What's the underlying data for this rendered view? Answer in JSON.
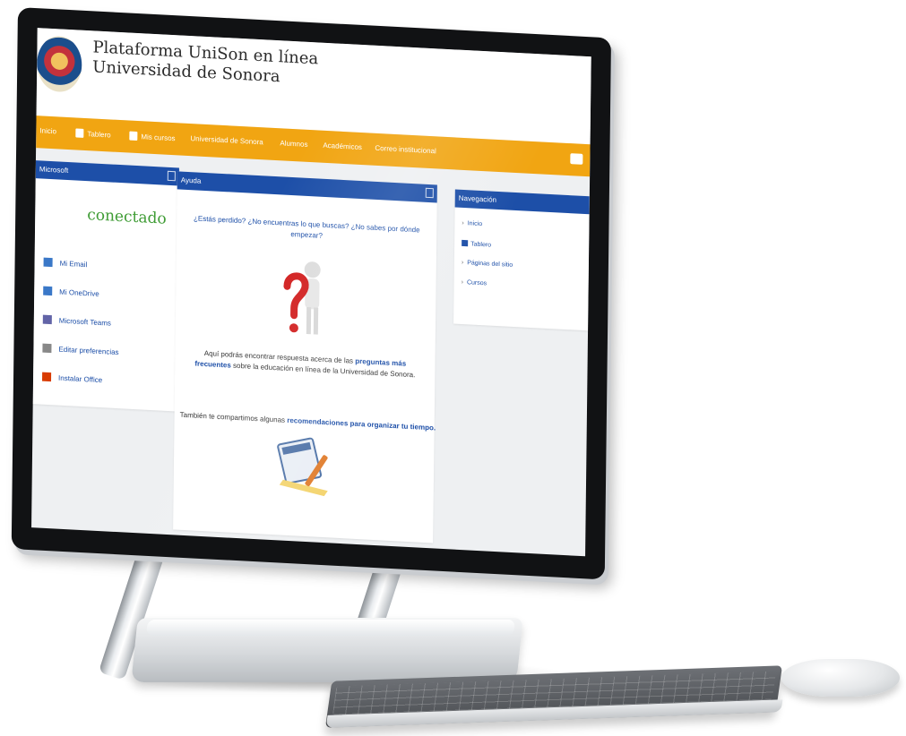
{
  "site": {
    "title_line1": "Plataforma UniSon en línea",
    "title_line2": "Universidad de Sonora"
  },
  "navbar": {
    "items": [
      {
        "label": "Inicio",
        "icon": "none"
      },
      {
        "label": "Tablero",
        "icon": "dashboard-icon"
      },
      {
        "label": "Mis cursos",
        "icon": "courses-icon"
      },
      {
        "label": "Universidad de Sonora",
        "icon": "none"
      },
      {
        "label": "Alumnos",
        "icon": "none"
      },
      {
        "label": "Académicos",
        "icon": "none"
      },
      {
        "label": "Correo institucional",
        "icon": "none"
      }
    ],
    "accent_color": "#f1a512"
  },
  "microsoft_block": {
    "title": "Microsoft",
    "status": "conectado",
    "links": [
      {
        "label": "Mi Email",
        "icon": "email-icon"
      },
      {
        "label": "Mi OneDrive",
        "icon": "onedrive-icon"
      },
      {
        "label": "Microsoft Teams",
        "icon": "teams-icon"
      },
      {
        "label": "Editar preferencias",
        "icon": "settings-icon"
      },
      {
        "label": "Instalar Office",
        "icon": "office-icon"
      }
    ]
  },
  "help_block": {
    "title": "Ayuda",
    "question": "¿Estás perdido? ¿No encuentras lo que buscas? ¿No sabes por dónde empezar?",
    "text_before": "Aquí podrás encontrar respuesta acerca de las ",
    "text_link": "preguntas más frecuentes",
    "text_after": " sobre la educación en línea de la Universidad de Sonora.",
    "text2_before": "También te compartimos algunas ",
    "text2_link": "recomendaciones para organizar tu tiempo."
  },
  "navigation_block": {
    "title": "Navegación",
    "items": [
      {
        "label": "Inicio",
        "icon": "bullet"
      },
      {
        "label": "Tablero",
        "icon": "home-icon"
      },
      {
        "label": "Páginas del sitio",
        "icon": "bullet"
      },
      {
        "label": "Cursos",
        "icon": "bullet"
      }
    ]
  },
  "colors": {
    "block_header": "#1d4fa8",
    "connected_text": "#3f9c35"
  }
}
